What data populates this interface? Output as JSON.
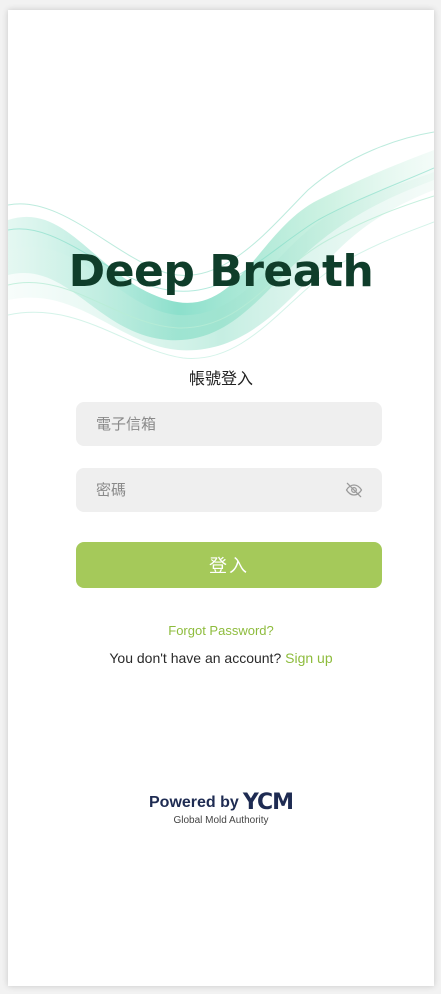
{
  "app": {
    "brand_name": "Deep Breath"
  },
  "login": {
    "title": "帳號登入",
    "email_placeholder": "電子信箱",
    "email_value": "",
    "password_placeholder": "密碼",
    "password_value": "",
    "password_toggle_icon": "eye-off-icon",
    "submit_label": "登入",
    "forgot_label": "Forgot Password?",
    "signup_prompt": "You don't have an account?",
    "signup_label": "Sign up"
  },
  "footer": {
    "powered_by": "Powered by",
    "company_logo_text": "YCM",
    "company_tagline": "Global Mold Authority"
  },
  "colors": {
    "brand_text": "#0f3d2a",
    "accent_green": "#a5c95a",
    "link_green": "#8ebc3d",
    "field_bg": "#efefef",
    "wave_teal": "#7fdcc6",
    "logo_navy": "#1e2b52"
  }
}
